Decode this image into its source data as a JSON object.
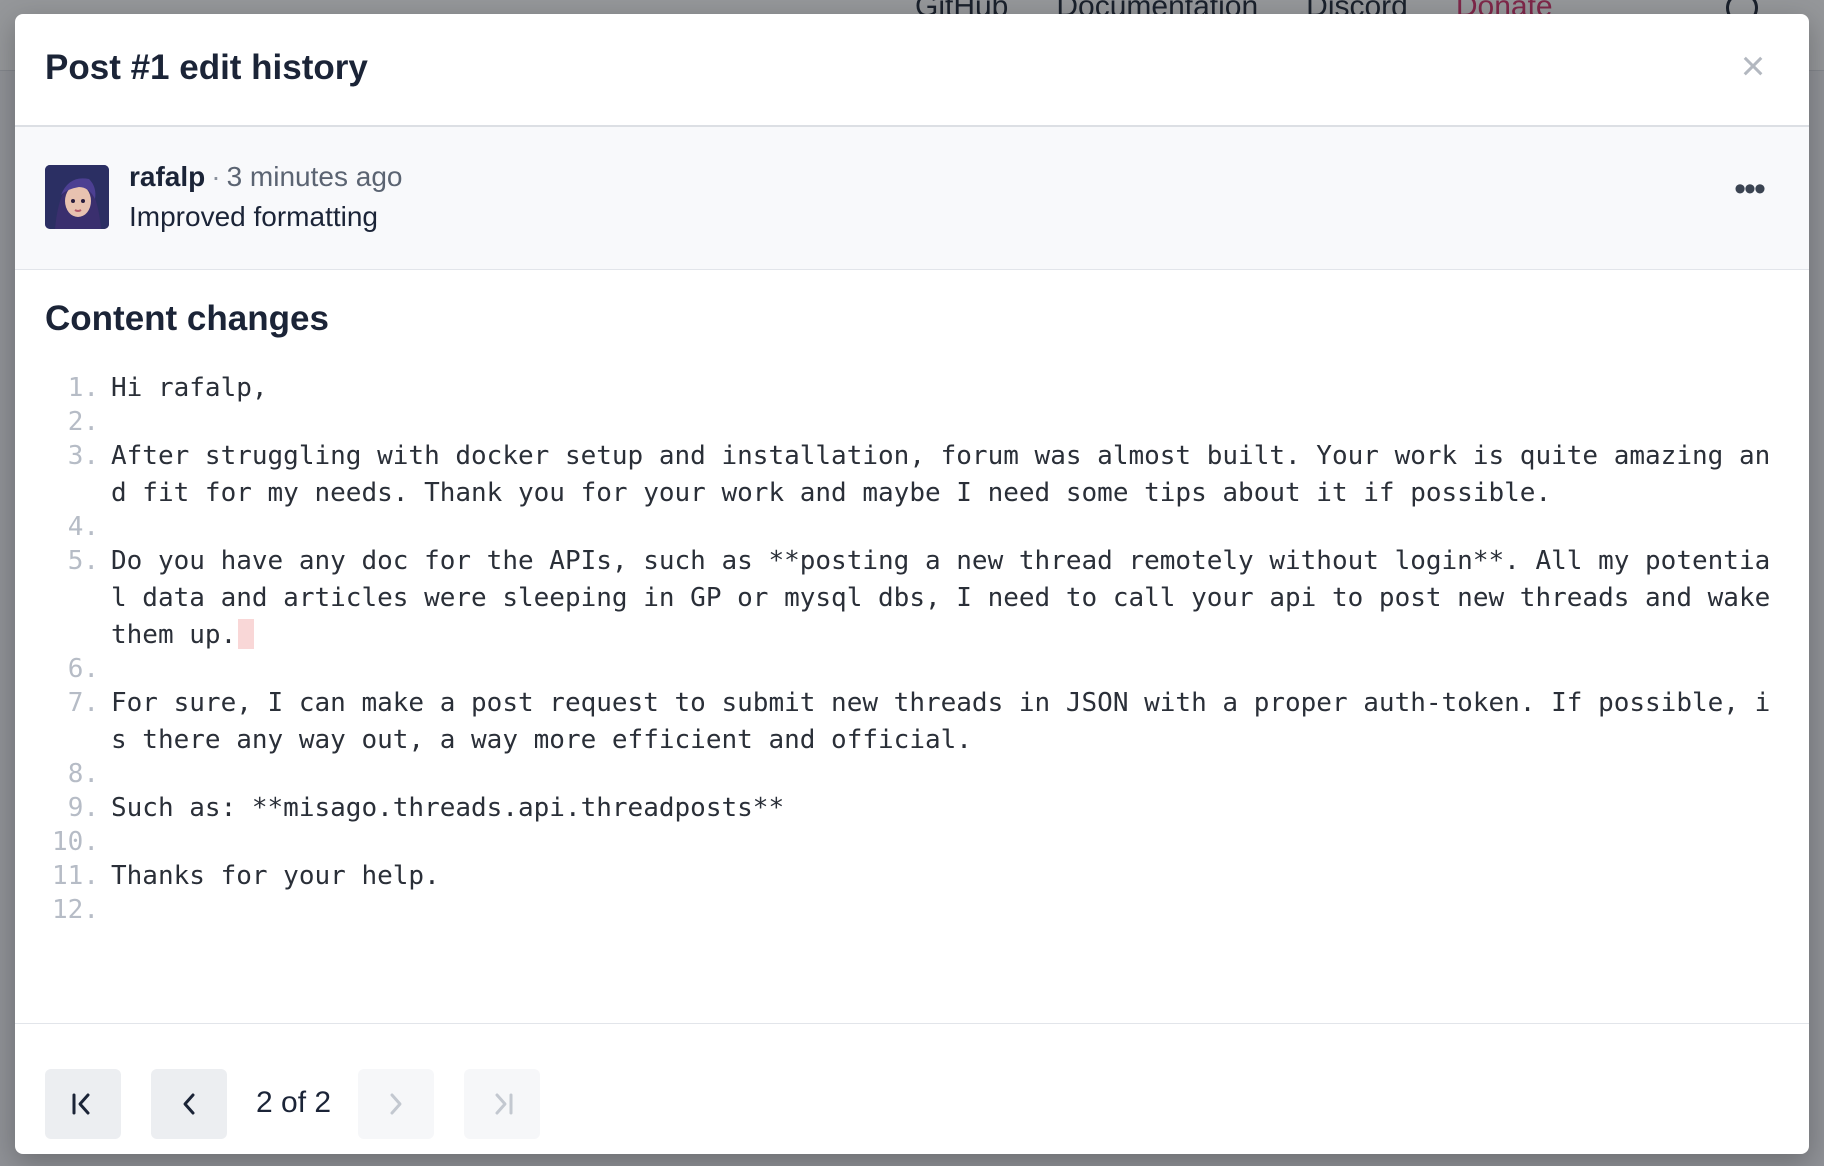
{
  "background": {
    "nav_links": [
      "GitHub",
      "Documentation",
      "Discord",
      "Donate"
    ]
  },
  "modal": {
    "title": "Post #1 edit history",
    "close_icon": "close-icon",
    "author": {
      "name": "rafalp",
      "separator": "·",
      "time": "3 minutes ago",
      "edit_reason": "Improved formatting",
      "more_icon": "more-horizontal-icon"
    },
    "section_title": "Content changes",
    "lines": [
      {
        "num": "1.",
        "text": "Hi rafalp,"
      },
      {
        "num": "2.",
        "text": ""
      },
      {
        "num": "3.",
        "text": "After struggling with docker setup and installation, forum was almost built. Your work is quite amazing and fit for my needs. Thank you for your work and maybe I need some tips about it if possible."
      },
      {
        "num": "4.",
        "text": ""
      },
      {
        "num": "5.",
        "text": "Do you have any doc for the APIs, such as **posting a new thread remotely without login**. All my potential data and articles were sleeping in GP or mysql dbs, I need to call your api to post new threads and wake them up."
      },
      {
        "num": "6.",
        "text": ""
      },
      {
        "num": "7.",
        "text": "For sure, I can make a post request to submit new threads in JSON with a proper auth-token. If possible, is there any way out, a way more efficient and official."
      },
      {
        "num": "8.",
        "text": ""
      },
      {
        "num": "9.",
        "text": "Such as: **misago.threads.api.threadposts**"
      },
      {
        "num": "10.",
        "text": ""
      },
      {
        "num": "11.",
        "text": "Thanks for your help."
      },
      {
        "num": "12.",
        "text": ""
      }
    ],
    "pagination": {
      "label": "2 of 2",
      "first_icon": "first-page-icon",
      "prev_icon": "chevron-left-icon",
      "next_icon": "chevron-right-icon",
      "last_icon": "last-page-icon"
    }
  }
}
